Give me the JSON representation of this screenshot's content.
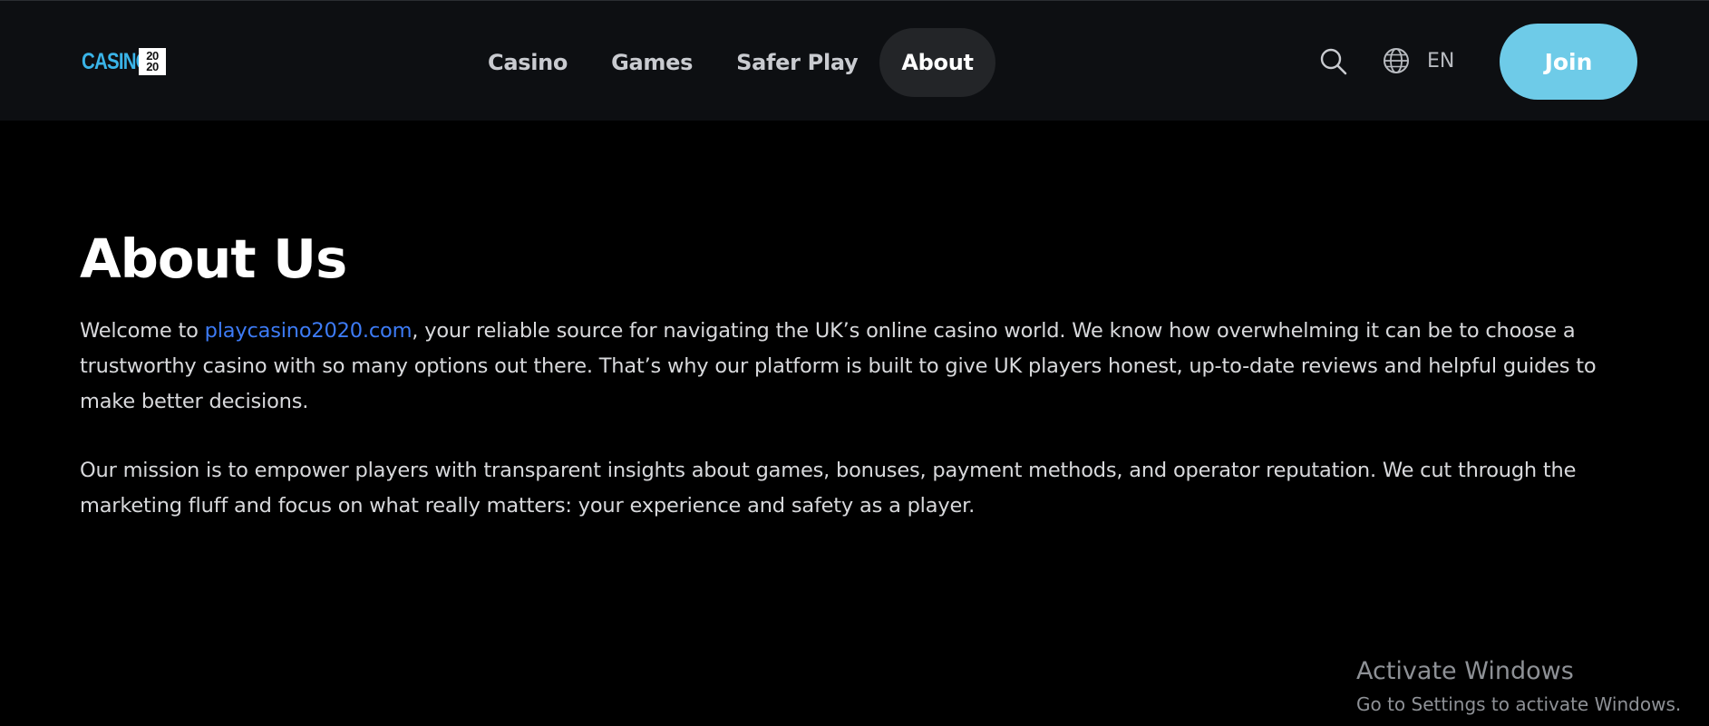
{
  "header": {
    "logo": {
      "text": "CASINO",
      "box_top": "20",
      "box_bottom": "20"
    },
    "nav": [
      {
        "label": "Casino",
        "active": false
      },
      {
        "label": "Games",
        "active": false
      },
      {
        "label": "Safer Play",
        "active": false
      },
      {
        "label": "About",
        "active": true
      }
    ],
    "icons": {
      "search": "search-icon",
      "language": "globe-icon"
    },
    "language": "EN",
    "join_label": "Join"
  },
  "main": {
    "title": "About Us",
    "para1": {
      "before_link": "Welcome to ",
      "link_text": "playcasino2020.com",
      "after_link": ", your reliable source for navigating the UK’s online casino world. We know how overwhelming it can be to choose a trustworthy casino with so many options out there. That’s why our platform is built to give UK players honest, up-to-date reviews and helpful guides to make better decisions."
    },
    "para2": "Our mission is to empower players with transparent insights about games, bonuses, payment methods, and operator reputation. We cut through the marketing fluff and focus on what really matters: your experience and safety as a player."
  },
  "os_watermark": {
    "title": "Activate Windows",
    "subtitle": "Go to Settings to activate Windows."
  },
  "colors": {
    "page_bg": "#000000",
    "header_bg": "#0d0f12",
    "nav_active_bg": "#232528",
    "join_bg": "#6ecbe8",
    "link": "#3d7bf5",
    "logo_blue": "#3ab4e8"
  }
}
